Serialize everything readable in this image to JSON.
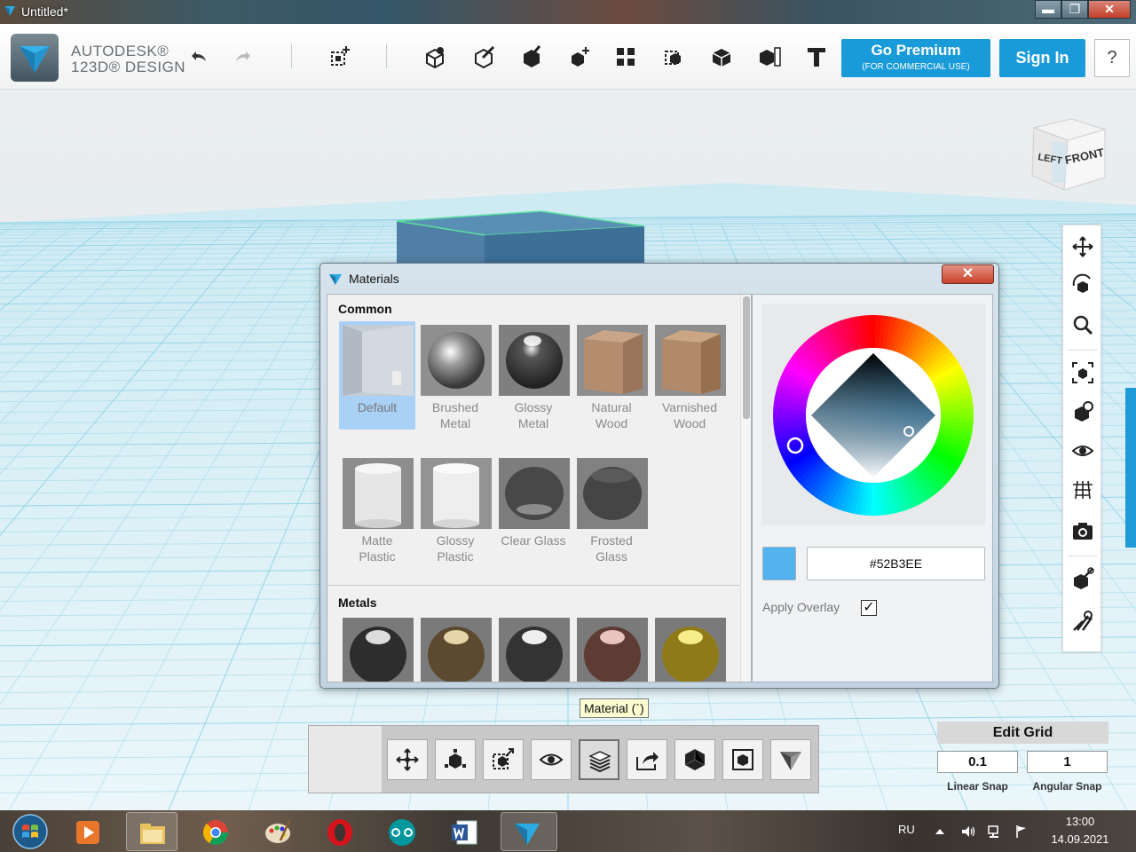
{
  "window": {
    "title": "Untitled*",
    "minimize": "▬",
    "maximize": "❐",
    "close": "✕"
  },
  "brand": {
    "line1": "AUTODESK®",
    "line2": "123D® DESIGN"
  },
  "header": {
    "go_premium": "Go Premium",
    "go_premium_sub": "(FOR COMMERCIAL USE)",
    "sign_in": "Sign In",
    "help": "?"
  },
  "viewcube": {
    "left": "LEFT",
    "front": "FRONT"
  },
  "materials_dialog": {
    "title": "Materials",
    "close": "✕",
    "common_heading": "Common",
    "metals_heading": "Metals",
    "common": [
      {
        "line1": "Default",
        "line2": ""
      },
      {
        "line1": "Brushed",
        "line2": "Metal"
      },
      {
        "line1": "Glossy",
        "line2": "Metal"
      },
      {
        "line1": "Natural",
        "line2": "Wood"
      },
      {
        "line1": "Varnished",
        "line2": "Wood"
      },
      {
        "line1": "Matte",
        "line2": "Plastic"
      },
      {
        "line1": "Glossy",
        "line2": "Plastic"
      },
      {
        "line1": "Clear Glass",
        "line2": ""
      },
      {
        "line1": "Frosted",
        "line2": "Glass"
      }
    ],
    "hex_value": "#52B3EE",
    "swatch_color": "#52B3EE",
    "apply_overlay": "Apply Overlay",
    "apply_overlay_checked": "✓"
  },
  "tooltip": "Material (`)",
  "edit_grid": {
    "title": "Edit Grid",
    "linear_value": "0.1",
    "angular_value": "1",
    "linear_label": "Linear Snap",
    "angular_label": "Angular Snap"
  },
  "taskbar": {
    "lang": "RU",
    "time": "13:00",
    "date": "14.09.2021"
  },
  "colors": {
    "accent": "#1A9BD9",
    "selected_material": "#A9D0F5",
    "box_top": "#5A8FB5"
  }
}
